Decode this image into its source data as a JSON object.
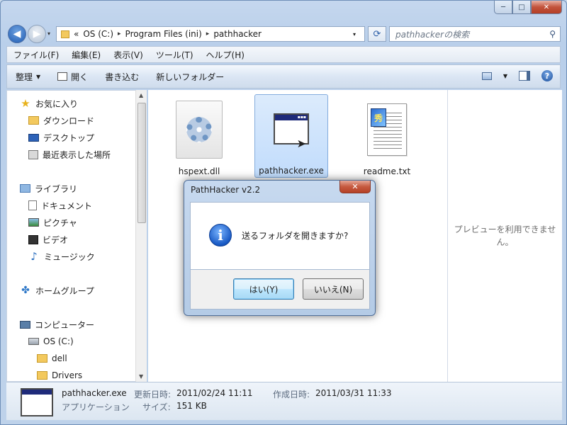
{
  "window": {
    "caption_buttons": {
      "minimize": "─",
      "maximize": "□",
      "close": "✕"
    }
  },
  "address": {
    "chevron": "«",
    "crumbs": [
      "OS (C:)",
      "Program Files (ini)",
      "pathhacker"
    ],
    "separator": "▸",
    "dropdown": "▾",
    "refresh": "⟳",
    "search_placeholder": "pathhackerの検索",
    "search_icon": "⚲"
  },
  "nav_buttons": {
    "back": "◀",
    "forward": "▶",
    "history": "▾"
  },
  "menubar": [
    "ファイル(F)",
    "編集(E)",
    "表示(V)",
    "ツール(T)",
    "ヘルプ(H)"
  ],
  "toolbar": {
    "organize": "整理",
    "open": "開く",
    "burn": "書き込む",
    "new_folder": "新しいフォルダー",
    "help": "?"
  },
  "sidebar": {
    "favorites": "お気に入り",
    "downloads": "ダウンロード",
    "desktop": "デスクトップ",
    "recent": "最近表示した場所",
    "libraries": "ライブラリ",
    "documents": "ドキュメント",
    "pictures": "ピクチャ",
    "videos": "ビデオ",
    "music": "ミュージック",
    "homegroup": "ホームグループ",
    "computer": "コンピューター",
    "drive": "OS (C:)",
    "dell": "dell",
    "drivers": "Drivers"
  },
  "files": [
    {
      "name": "hspext.dll",
      "icon": "dll-gear-icon"
    },
    {
      "name": "pathhacker.exe",
      "icon": "app-window-icon",
      "selected": true
    },
    {
      "name": "readme.txt",
      "icon": "text-file-icon"
    }
  ],
  "preview": {
    "text": "プレビューを利用できません。"
  },
  "details": {
    "name": "pathhacker.exe",
    "type": "アプリケーション",
    "modified_label": "更新日時:",
    "modified_value": "2011/02/24 11:11",
    "created_label": "作成日時:",
    "created_value": "2011/03/31 11:33",
    "size_label": "サイズ:",
    "size_value": "151 KB"
  },
  "dialog": {
    "title": "PathHacker v2.2",
    "close": "✕",
    "message": "送るフォルダを開きますか?",
    "yes": "はい(Y)",
    "no": "いいえ(N)",
    "info_glyph": "i"
  }
}
